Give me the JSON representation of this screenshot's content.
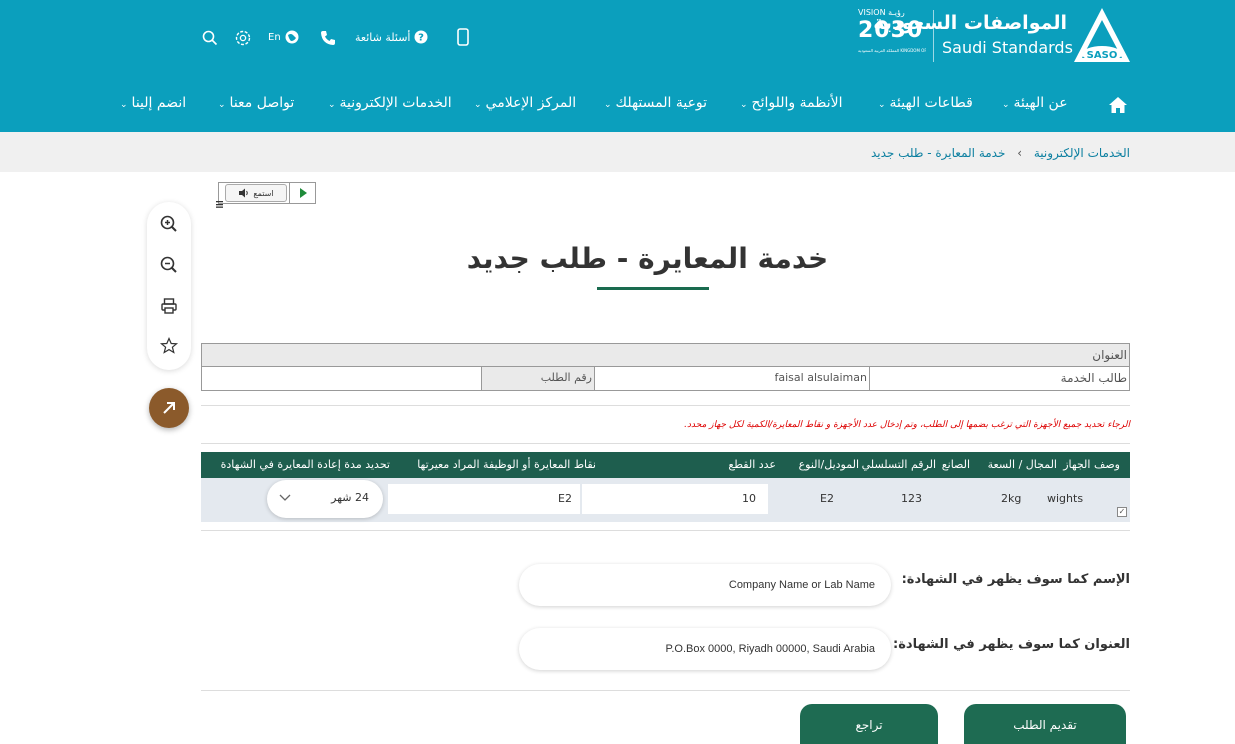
{
  "header": {
    "brand_ar": "المواصفات السعودية",
    "brand_en": "Saudi Standards",
    "logo_text": "SASO",
    "vision_top": "VISION رؤيـة",
    "vision_year": "2030",
    "vision_sub": "المملكة العربية السعودية KINGDOM OF SAUDI ARABIA",
    "faq_label": "أسئلة شائعة",
    "lang_label": "En"
  },
  "nav": {
    "items": [
      "عن الهيئة",
      "قطاعات الهيئة",
      "الأنظمة واللوائح",
      "توعية المستهلك",
      "المركز الإعلامي",
      "الخدمات الإلكترونية",
      "تواصل معنا",
      "انضم إلينا"
    ]
  },
  "breadcrumb": {
    "parent": "الخدمات الإلكترونية",
    "current": "خدمة المعايرة - طلب جديد"
  },
  "listen": {
    "label": "استمع"
  },
  "page": {
    "title": "خدمة المعايرة - طلب جديد"
  },
  "info": {
    "address_label": "العنوان",
    "requester_label": "طالب الخدمة",
    "requester_value": "faisal alsulaiman",
    "request_no_label": "رقم الطلب",
    "request_no_value": ""
  },
  "warning": "الرجاء تحديد جميع الأجهزة التي ترغب بضمها إلى الطلب، وتم إدخال عدد الأجهزة و نقاط المعايرة/الكمية لكل جهاز محدد.",
  "devices": {
    "headers": {
      "desc": "وصف الجهاز",
      "range": "المجال / السعة",
      "maker": "الصانع",
      "serial": "الرقم التسلسلي",
      "model": "الموديل/النوع",
      "qty": "عدد القطع",
      "points": "نقاط المعايرة أو الوظيفة المراد معيرتها",
      "period": "تحديد مدة إعادة المعايرة في الشهادة"
    },
    "row": {
      "desc": "wights",
      "range": "2kg",
      "maker": "",
      "serial": "123",
      "model": "E2",
      "qty": "10",
      "points": "E2",
      "period": "24 شهر"
    }
  },
  "form": {
    "name_label": "الإسم كما سوف يظهر في الشهادة:",
    "name_value": "Company Name or Lab Name",
    "address_label": "العنوان كما سوف يظهر في الشهادة:",
    "address_value": "P.O.Box 0000, Riyadh 00000, Saudi Arabia"
  },
  "buttons": {
    "submit": "تقديم الطلب",
    "back": "تراجع"
  },
  "colors": {
    "header_bg": "#0b9fbd",
    "primary_green": "#1e6b52",
    "table_head": "#1e5e4e",
    "share_btn": "#8b5a2b",
    "warning": "#dd0000"
  }
}
